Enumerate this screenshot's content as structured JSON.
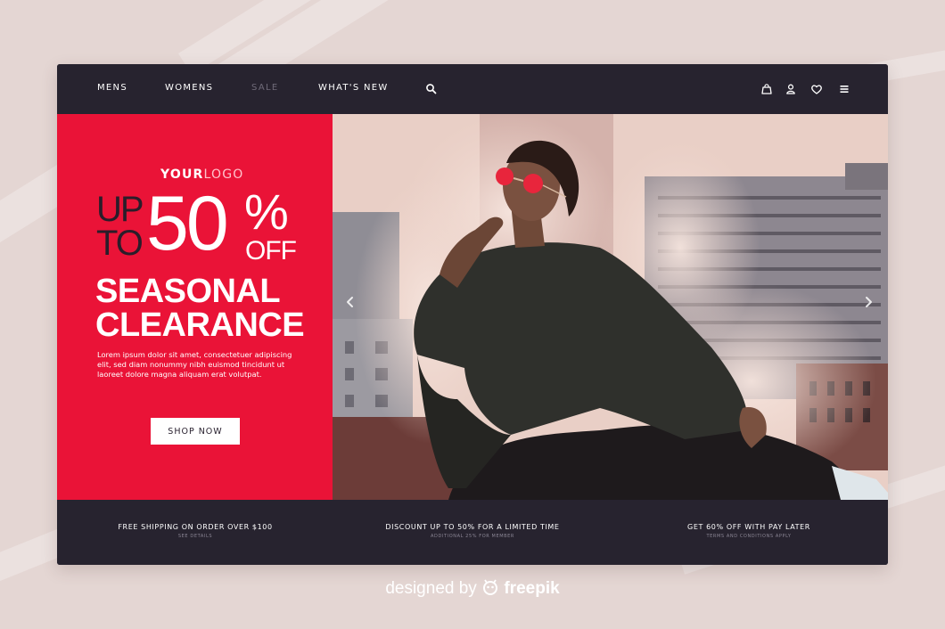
{
  "nav": {
    "links": [
      "MENS",
      "WOMENS",
      "SALE",
      "WHAT'S NEW"
    ],
    "icons": [
      "search-icon",
      "shopping-bag-icon",
      "user-icon",
      "heart-icon",
      "menu-icon"
    ]
  },
  "promo": {
    "logo_bold": "YOUR",
    "logo_light": "LOGO",
    "up": "UP",
    "to": "TO",
    "percent": "50",
    "percent_sign": "%",
    "off": "OFF",
    "headline_1": "SEASONAL",
    "headline_2": "CLEARANCE",
    "body": "Lorem ipsum dolor sit amet, consectetuer adipiscing elit, sed diam nonummy nibh euismod tincidunt ut laoreet dolore magna aliquam erat volutpat.",
    "cta": "SHOP NOW",
    "color": "#ea1337"
  },
  "hero": {
    "prev_icon": "chevron-left-icon",
    "next_icon": "chevron-right-icon"
  },
  "footer": {
    "features": [
      {
        "title": "FREE SHIPPING ON ORDER OVER $100",
        "sub": "SEE DETAILS"
      },
      {
        "title": "DISCOUNT UP TO 50% FOR A LIMITED TIME",
        "sub": "ADDITIONAL 25% FOR MEMBER"
      },
      {
        "title": "GET 60% OFF WITH PAY LATER",
        "sub": "TERMS AND CONDITIONS APPLY"
      }
    ]
  },
  "credit": {
    "prefix": "designed by",
    "brand": "freepik"
  },
  "colors": {
    "page_bg": "#e4d6d3",
    "dark": "#27232f",
    "accent": "#ea1337"
  }
}
